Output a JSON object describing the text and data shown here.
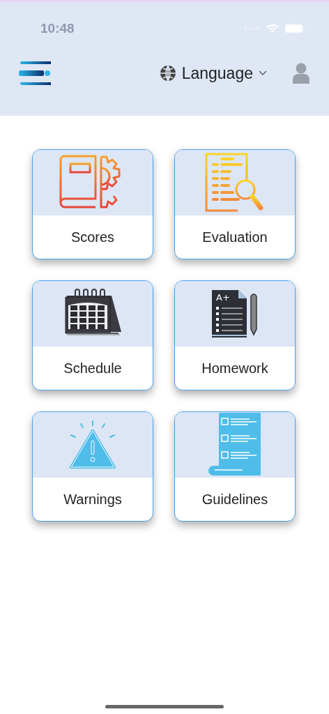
{
  "status_bar": {
    "time": "10:48"
  },
  "header": {
    "language": "Language"
  },
  "tiles": [
    {
      "kind": "scores",
      "label": "Scores"
    },
    {
      "kind": "evaluation",
      "label": "Evaluation"
    },
    {
      "kind": "schedule",
      "label": "Schedule"
    },
    {
      "kind": "homework",
      "label": "Homework"
    },
    {
      "kind": "warnings",
      "label": "Warnings"
    },
    {
      "kind": "guidelines",
      "label": "Guidelines"
    }
  ],
  "homework_icon": {
    "grade": "A+"
  }
}
